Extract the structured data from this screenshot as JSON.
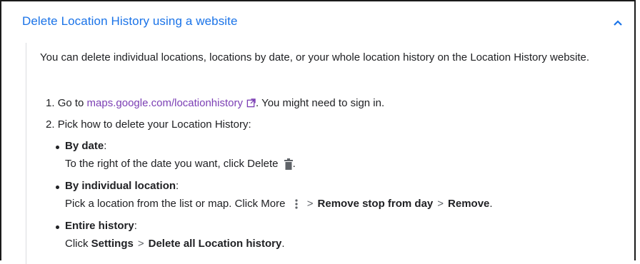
{
  "header": {
    "title": "Delete Location History using a website",
    "expand_icon": "chevron-up-icon"
  },
  "intro": "You can delete individual locations, locations by date, or your whole location history on the Location History website.",
  "steps": [
    {
      "number": "1.",
      "prefix": "Go to",
      "link_text": "maps.google.com/locationhistory",
      "link_icon": "external-link-icon",
      "suffix": ". You might need to sign in."
    },
    {
      "number": "2.",
      "text": "Pick how to delete your Location History:"
    }
  ],
  "options": [
    {
      "title": "By date",
      "title_colon": ":",
      "description": "To the right of the date you want, click Delete",
      "icon": "trash-icon",
      "description_end": "."
    },
    {
      "title": "By individual location",
      "title_colon": ":",
      "description": "Pick a location from the list or map. Click More",
      "icon": "more-vert-icon",
      "path": [
        "Remove stop from day",
        "Remove"
      ],
      "description_end": "."
    },
    {
      "title": "Entire history",
      "title_colon": ":",
      "description": "Click",
      "path": [
        "Settings",
        "Delete all Location history"
      ],
      "description_end": "."
    }
  ],
  "separator": ">",
  "colors": {
    "header_link": "#1a73e8",
    "body_link": "#7b3eb4",
    "text": "#202124"
  }
}
